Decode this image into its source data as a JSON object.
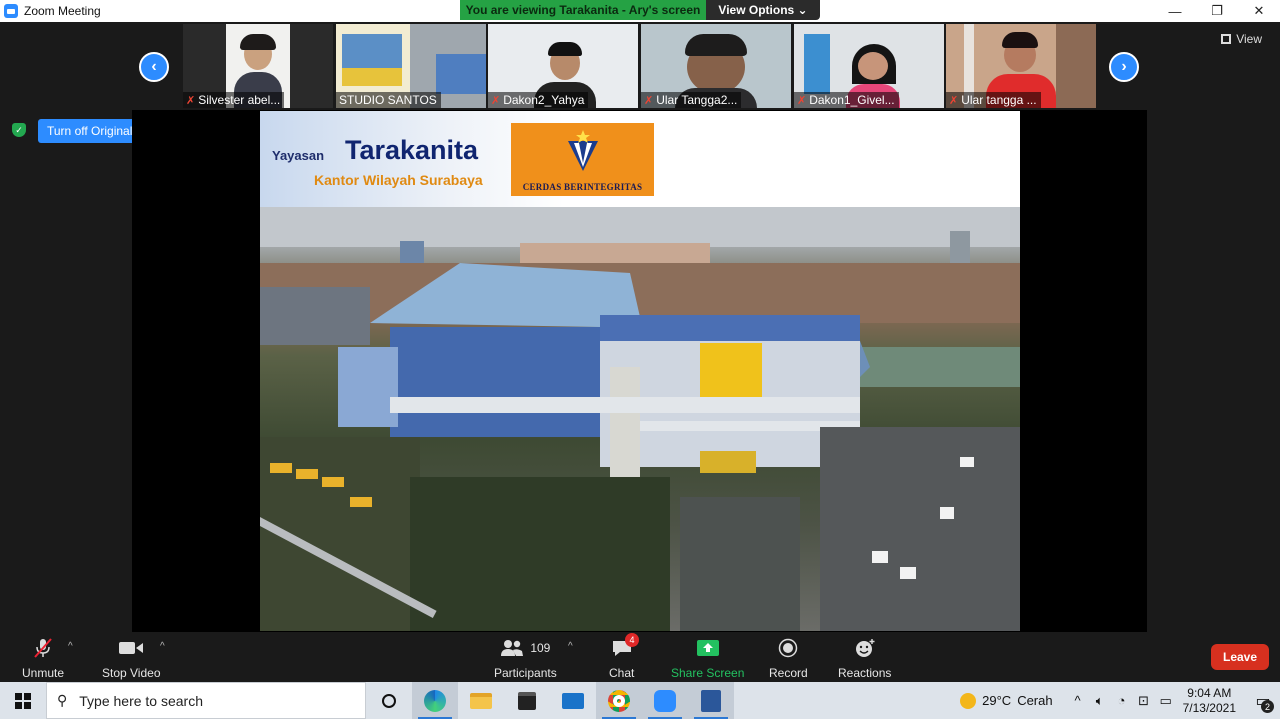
{
  "window": {
    "title": "Zoom Meeting",
    "minimize": "—",
    "restore": "❐",
    "close": "✕"
  },
  "banner": {
    "viewing": "You are viewing Tarakanita - Ary's screen",
    "view_options": "View Options ⌄"
  },
  "gallery": {
    "prev": "‹",
    "next": "›",
    "view_label": "View",
    "participants": [
      {
        "name": "Silvester abel...",
        "muted": true
      },
      {
        "name": "STUDIO SANTOS",
        "muted": false
      },
      {
        "name": "Dakon2_Yahya",
        "muted": true
      },
      {
        "name": "Ular Tangga2...",
        "muted": true
      },
      {
        "name": "Dakon1_Givel...",
        "muted": true
      },
      {
        "name": "Ular tangga ...",
        "muted": true
      }
    ]
  },
  "sound": {
    "button_label": "Turn off Original Sound",
    "dropdown": "▾"
  },
  "slide": {
    "brand_small": "Yayasan",
    "brand_big": "Tarakanita",
    "brand_sub": "Kantor Wilayah Surabaya",
    "logo_caption": "CERDAS BERINTEGRITAS"
  },
  "toolbar": {
    "unmute": "Unmute",
    "stop_video": "Stop Video",
    "participants": "Participants",
    "participants_count": "109",
    "chat": "Chat",
    "chat_badge": "4",
    "share_screen": "Share Screen",
    "record": "Record",
    "reactions": "Reactions",
    "leave": "Leave"
  },
  "taskbar": {
    "search_placeholder": "Type here to search",
    "weather_temp": "29°C",
    "weather_text": "Cerah",
    "time": "9:04 AM",
    "date": "7/13/2021",
    "notifications": "2"
  },
  "colors": {
    "zoom_blue": "#2d8cff",
    "banner_green": "#25a244",
    "leave_red": "#d7301f",
    "share_green": "#23c160"
  }
}
